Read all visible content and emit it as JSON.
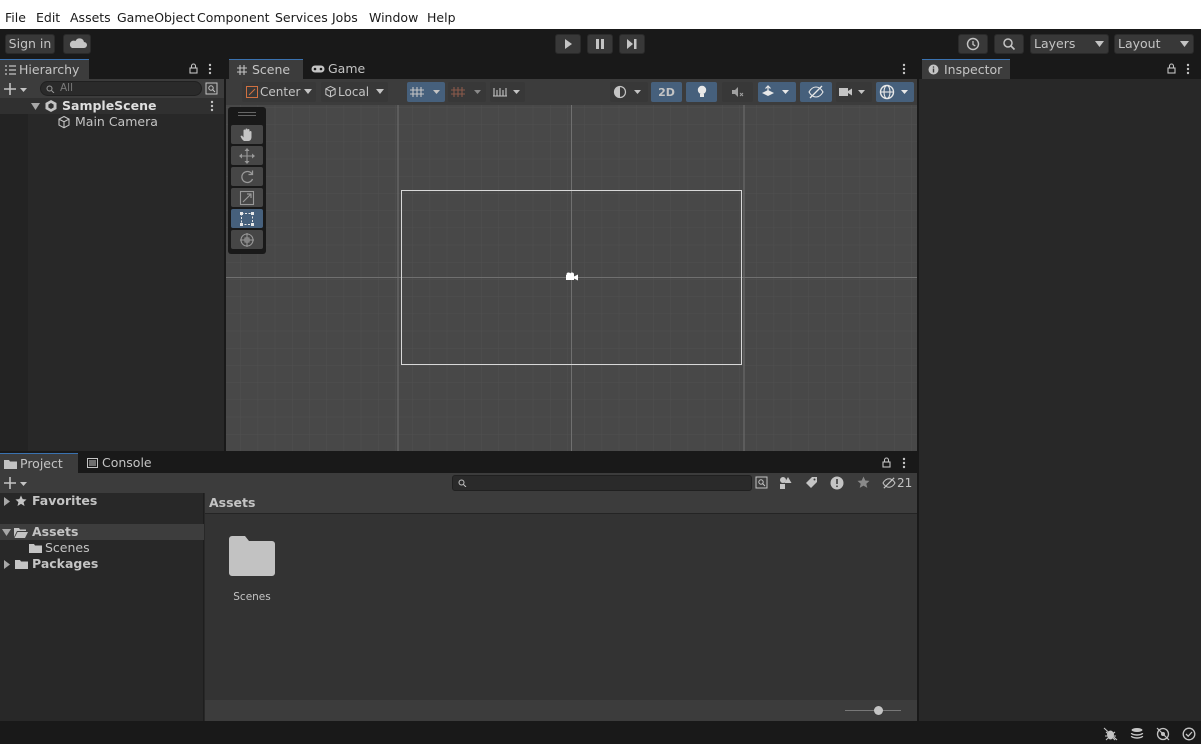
{
  "menu": {
    "items": [
      "File",
      "Edit",
      "Assets",
      "GameObject",
      "Component",
      "Services",
      "Jobs",
      "Window",
      "Help"
    ]
  },
  "toolbar": {
    "sign_in": "Sign in",
    "layers": "Layers",
    "layout": "Layout"
  },
  "hierarchy": {
    "tab": "Hierarchy",
    "search_placeholder": "All",
    "scene": "SampleScene",
    "objects": [
      "Main Camera"
    ]
  },
  "scene_view": {
    "tabs": [
      "Scene",
      "Game"
    ],
    "pivot_mode": "Center",
    "pivot_rotation": "Local",
    "mode_2d": "2D"
  },
  "inspector": {
    "tab": "Inspector"
  },
  "project": {
    "tabs": [
      "Project",
      "Console"
    ],
    "hidden_count": "21",
    "tree": {
      "favorites": "Favorites",
      "assets": "Assets",
      "scenes": "Scenes",
      "packages": "Packages"
    },
    "breadcrumb": "Assets",
    "items": [
      {
        "name": "Scenes",
        "icon": "folder-icon"
      }
    ]
  },
  "colors": {
    "accent": "#3a72b0",
    "selected_tool": "#46607c",
    "panel": "#282828",
    "dark": "#191919"
  }
}
